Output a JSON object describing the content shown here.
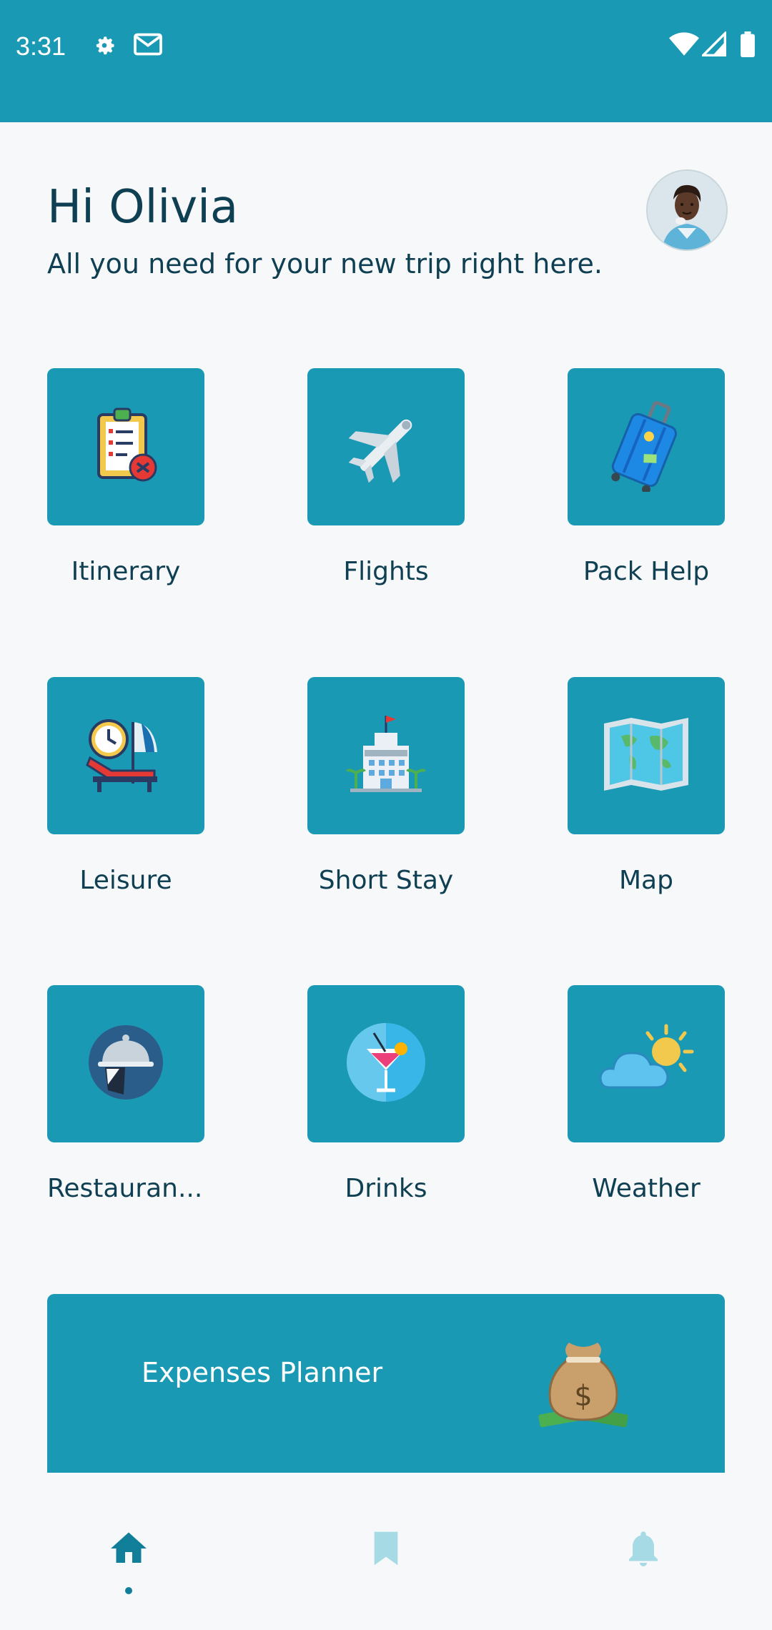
{
  "status_bar": {
    "time": "3:31",
    "icons": [
      "gear-icon",
      "mail-icon",
      "wifi-icon",
      "signal-icon",
      "battery-icon"
    ]
  },
  "header": {
    "greeting": "Hi Olivia",
    "subtitle": "All you need for your new trip right here."
  },
  "tiles": [
    {
      "label": "Itinerary",
      "icon": "clipboard-icon"
    },
    {
      "label": "Flights",
      "icon": "airplane-icon"
    },
    {
      "label": "Pack Help",
      "icon": "suitcase-icon"
    },
    {
      "label": "Leisure",
      "icon": "beach-chair-icon"
    },
    {
      "label": "Short Stay",
      "icon": "hotel-icon"
    },
    {
      "label": "Map",
      "icon": "map-icon"
    },
    {
      "label": "Restauran...",
      "icon": "cloche-icon"
    },
    {
      "label": "Drinks",
      "icon": "cocktail-icon"
    },
    {
      "label": "Weather",
      "icon": "weather-icon"
    }
  ],
  "expenses": {
    "label": "Expenses Planner",
    "icon": "money-bag-icon"
  },
  "bottom_nav": {
    "items": [
      {
        "icon": "home-icon",
        "active": true
      },
      {
        "icon": "bookmark-icon",
        "active": false
      },
      {
        "icon": "bell-icon",
        "active": false
      }
    ]
  },
  "colors": {
    "primary": "#1a99b4",
    "text": "#0f3f52",
    "background": "#f7f8f9",
    "nav_inactive": "#a6dbe6"
  }
}
